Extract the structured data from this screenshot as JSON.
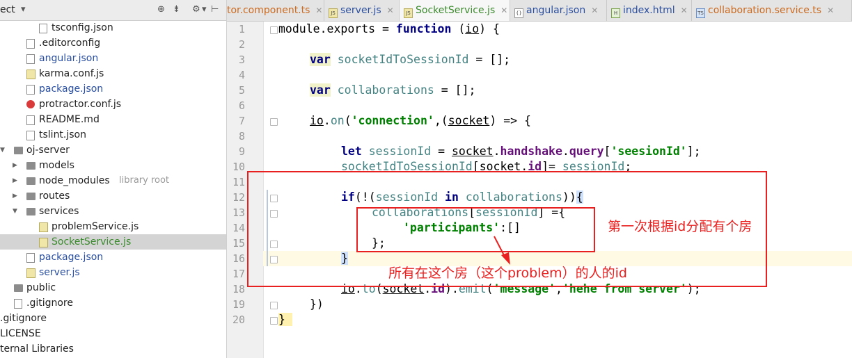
{
  "sidebar": {
    "title": "ect",
    "header_icons": [
      "target-icon",
      "collapse-icon",
      "gear-icon",
      "hide-icon"
    ],
    "items": [
      {
        "label": "tsconfig.json",
        "icon": "json-file-icon",
        "depth": 2,
        "color": "#222222"
      },
      {
        "label": ".editorconfig",
        "icon": "text-file-icon",
        "depth": 1,
        "color": "#222222"
      },
      {
        "label": "angular.json",
        "icon": "json-file-icon",
        "depth": 1,
        "color": "#2a4fa0"
      },
      {
        "label": "karma.conf.js",
        "icon": "js-file-icon",
        "depth": 1,
        "color": "#222222"
      },
      {
        "label": "package.json",
        "icon": "json-file-icon",
        "depth": 1,
        "color": "#2a4fa0"
      },
      {
        "label": "protractor.conf.js",
        "icon": "error-file-icon",
        "depth": 1,
        "color": "#222222"
      },
      {
        "label": "README.md",
        "icon": "text-file-icon",
        "depth": 1,
        "color": "#222222"
      },
      {
        "label": "tslint.json",
        "icon": "json-file-icon",
        "depth": 1,
        "color": "#222222"
      },
      {
        "label": "oj-server",
        "icon": "folder-icon",
        "depth": 0,
        "color": "#222222",
        "arrow": "down"
      },
      {
        "label": "models",
        "icon": "folder-icon",
        "depth": 1,
        "color": "#222222",
        "arrow": "right"
      },
      {
        "label": "node_modules",
        "hint": "library root",
        "icon": "folder-icon",
        "depth": 1,
        "color": "#222222",
        "arrow": "right"
      },
      {
        "label": "routes",
        "icon": "folder-icon",
        "depth": 1,
        "color": "#222222",
        "arrow": "right"
      },
      {
        "label": "services",
        "icon": "folder-icon",
        "depth": 1,
        "color": "#222222",
        "arrow": "down"
      },
      {
        "label": "problemService.js",
        "icon": "js-file-icon",
        "depth": 2,
        "color": "#222222"
      },
      {
        "label": "SocketService.js",
        "icon": "js-file-icon",
        "depth": 2,
        "color": "#3c8a2e",
        "selected": true
      },
      {
        "label": "package.json",
        "icon": "json-file-icon",
        "depth": 1,
        "color": "#2a4fa0"
      },
      {
        "label": "server.js",
        "icon": "js-file-icon",
        "depth": 1,
        "color": "#2a4fa0"
      },
      {
        "label": "public",
        "icon": "folder-icon",
        "depth": 0,
        "color": "#222222"
      },
      {
        "label": ".gitignore",
        "icon": "text-file-icon",
        "depth": 0,
        "color": "#222222"
      },
      {
        "label": ".gitignore",
        "icon": "none",
        "depth": -1,
        "color": "#222222"
      },
      {
        "label": "LICENSE",
        "icon": "none",
        "depth": -1,
        "color": "#222222"
      },
      {
        "label": "ternal Libraries",
        "icon": "none",
        "depth": -1,
        "color": "#222222"
      }
    ]
  },
  "tabs": [
    {
      "label": "tor.component.ts",
      "icon": "",
      "color": "#cc6a1e",
      "active": false
    },
    {
      "label": "server.js",
      "icon": "JS",
      "color": "#2a4fa0",
      "active": false
    },
    {
      "label": "SocketService.js",
      "icon": "JS",
      "color": "#3c8a2e",
      "active": true
    },
    {
      "label": "angular.json",
      "icon": "{}",
      "color": "#2a4fa0",
      "active": false
    },
    {
      "label": "index.html",
      "icon": "H",
      "color": "#2a4fa0",
      "active": false
    },
    {
      "label": "collaboration.service.ts",
      "icon": "TS",
      "color": "#cc6a1e",
      "active": false
    }
  ],
  "editor": {
    "line_numbers": [
      "1",
      "2",
      "3",
      "4",
      "5",
      "6",
      "7",
      "8",
      "9",
      "10",
      "11",
      "12",
      "13",
      "14",
      "15",
      "16",
      "17",
      "18",
      "19",
      "20"
    ],
    "code": {
      "l1": {
        "a": "module",
        "b": ".",
        "c": "exports",
        "d": " = ",
        "e": "function",
        "f": " (",
        "g": "io",
        "h": ") {"
      },
      "l3": {
        "a": "var",
        "b": " socketIdToSessionId",
        "c": " = [];"
      },
      "l5": {
        "a": "var",
        "b": " collaborations",
        "c": " = [];"
      },
      "l7": {
        "a": "io",
        "b": ".",
        "c": "on",
        "d": "(",
        "e": "'connection'",
        "f": ",(",
        "g": "socket",
        "h": ") => {"
      },
      "l9": {
        "a": "let",
        "b": " sessionId",
        "c": " = ",
        "d": "socket",
        "e": ".",
        "f": "handshake",
        "g": ".",
        "h": "query",
        "i": "[",
        "j": "'seesionId'",
        "k": "];"
      },
      "l10": {
        "a": "socketIdToSessionId",
        "b": "[",
        "c": "socket",
        "d": ".",
        "e": "id",
        "f": "]= ",
        "g": "sessionId",
        "h": ";"
      },
      "l12": {
        "a": "if",
        "b": "(!(",
        "c": "sessionId",
        "d": " in ",
        "e": "collaborations",
        "f": "))",
        "g": "{"
      },
      "l13": {
        "a": "collaborations",
        "b": "[",
        "c": "sessionId",
        "d": "] ={"
      },
      "l14": {
        "a": "'participants'",
        "b": ":[]"
      },
      "l15": {
        "a": "};"
      },
      "l16": {
        "a": "}"
      },
      "l18": {
        "a": "io",
        "b": ".",
        "c": "to",
        "d": "(",
        "e": "socket",
        "f": ".",
        "g": "id",
        "h": ").",
        "i": "emit",
        "j": "(",
        "k": "'message'",
        "l": ",",
        "m": "'hehe from server'",
        "n": ");"
      },
      "l19": {
        "a": "})"
      },
      "l20": {
        "a": "}"
      }
    }
  },
  "annotations": {
    "note_first_assign": "第一次根据id分配有个房",
    "note_participants": "所有在这个房（这个problem）的人的id",
    "color": "#e8201f"
  }
}
